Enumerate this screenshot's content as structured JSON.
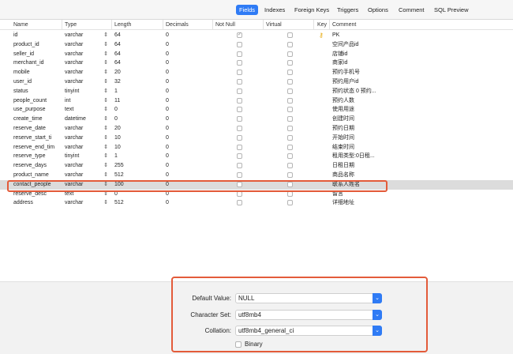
{
  "tabs": [
    {
      "label": "Fields",
      "active": true
    },
    {
      "label": "Indexes",
      "active": false
    },
    {
      "label": "Foreign Keys",
      "active": false
    },
    {
      "label": "Triggers",
      "active": false
    },
    {
      "label": "Options",
      "active": false
    },
    {
      "label": "Comment",
      "active": false
    },
    {
      "label": "SQL Preview",
      "active": false
    }
  ],
  "columns": {
    "name": "Name",
    "type": "Type",
    "length": "Length",
    "decimals": "Decimals",
    "not_null": "Not Null",
    "virtual": "Virtual",
    "key": "Key",
    "comment": "Comment"
  },
  "rows": [
    {
      "name": "id",
      "type": "varchar",
      "length": "64",
      "decimals": "0",
      "not_null": true,
      "key": true,
      "comment": "PK"
    },
    {
      "name": "product_id",
      "type": "varchar",
      "length": "64",
      "decimals": "0",
      "not_null": false,
      "key": false,
      "comment": "空间产品id"
    },
    {
      "name": "seller_id",
      "type": "varchar",
      "length": "64",
      "decimals": "0",
      "not_null": false,
      "key": false,
      "comment": "店铺id"
    },
    {
      "name": "merchant_id",
      "type": "varchar",
      "length": "64",
      "decimals": "0",
      "not_null": false,
      "key": false,
      "comment": "商家id"
    },
    {
      "name": "mobile",
      "type": "varchar",
      "length": "20",
      "decimals": "0",
      "not_null": false,
      "key": false,
      "comment": "预约手机号"
    },
    {
      "name": "user_id",
      "type": "varchar",
      "length": "32",
      "decimals": "0",
      "not_null": false,
      "key": false,
      "comment": "预约用户id"
    },
    {
      "name": "status",
      "type": "tinyint",
      "length": "1",
      "decimals": "0",
      "not_null": false,
      "key": false,
      "comment": "预约状态 0 预约..."
    },
    {
      "name": "people_count",
      "type": "int",
      "length": "11",
      "decimals": "0",
      "not_null": false,
      "key": false,
      "comment": "预约人数"
    },
    {
      "name": "use_purpose",
      "type": "text",
      "length": "0",
      "decimals": "0",
      "not_null": false,
      "key": false,
      "comment": "使用用途"
    },
    {
      "name": "create_time",
      "type": "datetime",
      "length": "0",
      "decimals": "0",
      "not_null": false,
      "key": false,
      "comment": "创建时间"
    },
    {
      "name": "reserve_date",
      "type": "varchar",
      "length": "20",
      "decimals": "0",
      "not_null": false,
      "key": false,
      "comment": "预约日期"
    },
    {
      "name": "reserve_start_ti",
      "type": "varchar",
      "length": "10",
      "decimals": "0",
      "not_null": false,
      "key": false,
      "comment": "开始时间"
    },
    {
      "name": "reserve_end_tim",
      "type": "varchar",
      "length": "10",
      "decimals": "0",
      "not_null": false,
      "key": false,
      "comment": "结束时间"
    },
    {
      "name": "reserve_type",
      "type": "tinyint",
      "length": "1",
      "decimals": "0",
      "not_null": false,
      "key": false,
      "comment": "租用类型:0日租..."
    },
    {
      "name": "reserve_days",
      "type": "varchar",
      "length": "255",
      "decimals": "0",
      "not_null": false,
      "key": false,
      "comment": "日租日期"
    },
    {
      "name": "product_name",
      "type": "varchar",
      "length": "512",
      "decimals": "0",
      "not_null": false,
      "key": false,
      "comment": "商品名称"
    },
    {
      "name": "contact_people",
      "type": "varchar",
      "length": "100",
      "decimals": "0",
      "not_null": false,
      "key": false,
      "comment": "联系人姓名",
      "selected": true
    },
    {
      "name": "reserve_desc",
      "type": "text",
      "length": "0",
      "decimals": "0",
      "not_null": false,
      "key": false,
      "comment": "留言"
    },
    {
      "name": "address",
      "type": "varchar",
      "length": "512",
      "decimals": "0",
      "not_null": false,
      "key": false,
      "comment": "详细地址"
    }
  ],
  "bottom": {
    "default_label": "Default Value:",
    "default_value": "NULL",
    "charset_label": "Character Set:",
    "charset_value": "utf8mb4",
    "collation_label": "Collation:",
    "collation_value": "utf8mb4_general_ci",
    "binary_label": "Binary"
  },
  "colors": {
    "accent": "#2f7bf5",
    "highlight": "#e35b3a",
    "selected_row": "#dcdcdc"
  }
}
